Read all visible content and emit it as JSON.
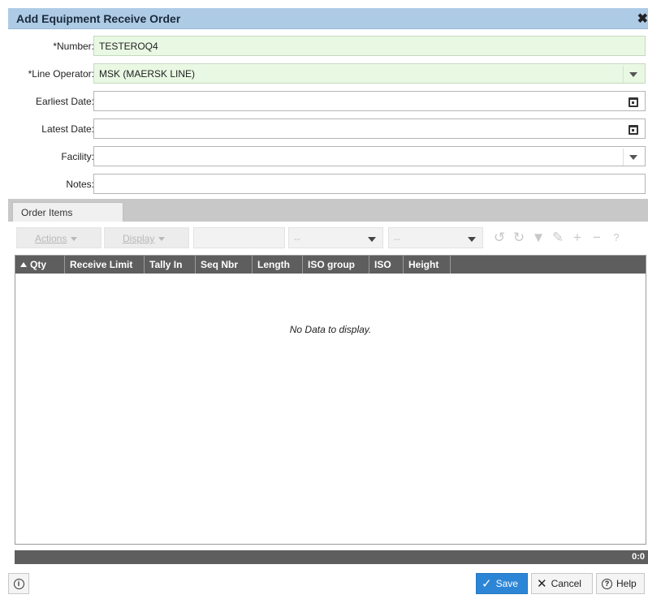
{
  "dialog": {
    "title": "Add Equipment Receive Order",
    "close_glyph": "✖"
  },
  "form": {
    "number": {
      "label": "*Number:",
      "value": "TESTEROQ4"
    },
    "line_operator": {
      "label": "*Line Operator:",
      "value": "MSK (MAERSK LINE)"
    },
    "earliest_date": {
      "label": "Earliest Date:",
      "value": ""
    },
    "latest_date": {
      "label": "Latest Date:",
      "value": ""
    },
    "facility": {
      "label": "Facility:",
      "value": ""
    },
    "notes": {
      "label": "Notes:",
      "value": ""
    }
  },
  "tabs": [
    {
      "label": "Order Items",
      "active": true
    }
  ],
  "toolbar": {
    "actions_label": "Actions",
    "display_label": "Display",
    "select1_value": "--",
    "select2_value": "--",
    "icons": [
      "history-icon",
      "refresh-icon",
      "filter-icon",
      "edit-icon",
      "add-icon",
      "remove-icon",
      "help-icon"
    ]
  },
  "grid": {
    "columns": [
      "Qty",
      "Receive Limit",
      "Tally In",
      "Seq Nbr",
      "Length",
      "ISO group",
      "ISO",
      "Height"
    ],
    "sorted_column": "Qty",
    "sort_direction": "ascending",
    "empty_message": "No Data to display.",
    "rows": []
  },
  "status": {
    "count": "0:0"
  },
  "footer": {
    "save_label": "Save",
    "cancel_label": "Cancel",
    "help_label": "Help"
  },
  "colors": {
    "title_bar": "#aecbe6",
    "required_field_bg": "#e9f8e3",
    "grid_header": "#5e5e5e",
    "primary_button": "#2d85d6"
  }
}
